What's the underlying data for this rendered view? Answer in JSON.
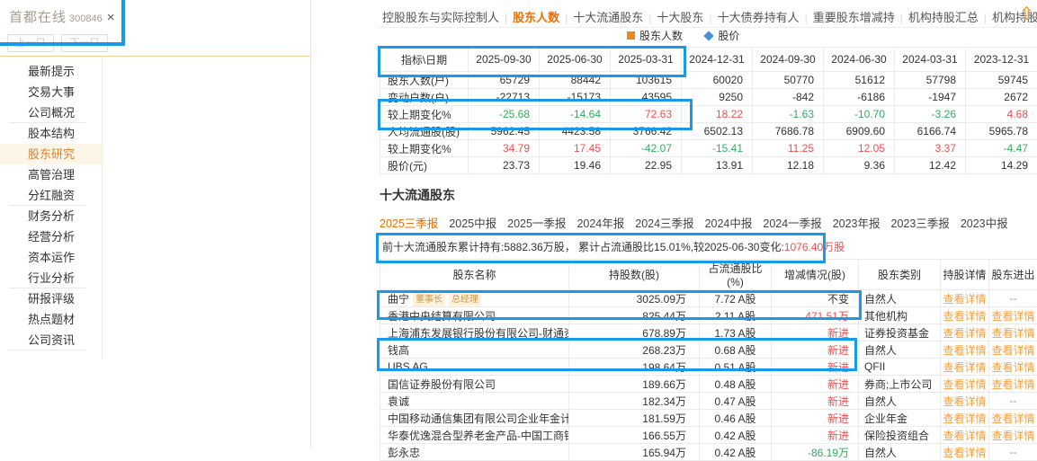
{
  "stock": {
    "name": "首都在线",
    "code": "300846",
    "close_icon": "×",
    "prev_label": "上一只",
    "next_label": "下一只"
  },
  "sidebar": {
    "items": [
      {
        "label": "最新提示"
      },
      {
        "label": "交易大事"
      },
      {
        "label": "公司概况",
        "divider": true
      },
      {
        "label": "股本结构"
      },
      {
        "label": "股东研究",
        "active": true
      },
      {
        "label": "高管治理"
      },
      {
        "label": "分红融资",
        "divider": true
      },
      {
        "label": "财务分析"
      },
      {
        "label": "经营分析"
      },
      {
        "label": "资本运作"
      },
      {
        "label": "行业分析",
        "divider": true
      },
      {
        "label": "研报评级"
      },
      {
        "label": "热点题材"
      },
      {
        "label": "公司资讯",
        "divider": true
      }
    ]
  },
  "nav": {
    "items": [
      "控股股东与实际控制人",
      "股东人数",
      "十大流通股东",
      "十大股东",
      "十大债券持有人",
      "重要股东增减持",
      "机构持股汇总",
      "机构持股明细"
    ],
    "active_index": 1
  },
  "icons": {
    "back_to_top": "⇧"
  },
  "legend": {
    "bar_label": "股东人数",
    "line_label": "股价"
  },
  "indicator_table": {
    "corner": "指标\\日期",
    "dates": [
      "2025-09-30",
      "2025-06-30",
      "2025-03-31",
      "2024-12-31",
      "2024-09-30",
      "2024-06-30",
      "2024-03-31",
      "2023-12-31"
    ],
    "rows": [
      {
        "label": "股东人数(户)",
        "values": [
          {
            "t": "65729"
          },
          {
            "t": "88442"
          },
          {
            "t": "103615"
          },
          {
            "t": "60020"
          },
          {
            "t": "50770"
          },
          {
            "t": "51612"
          },
          {
            "t": "57798"
          },
          {
            "t": "59745"
          }
        ]
      },
      {
        "label": "变动户数(户)",
        "values": [
          {
            "t": "-22713"
          },
          {
            "t": "-15173"
          },
          {
            "t": "43595"
          },
          {
            "t": "9250"
          },
          {
            "t": "-842"
          },
          {
            "t": "-6186"
          },
          {
            "t": "-1947"
          },
          {
            "t": "2672"
          }
        ]
      },
      {
        "label": "较上期变化%",
        "values": [
          {
            "t": "-25.68",
            "c": "down"
          },
          {
            "t": "-14.64",
            "c": "down"
          },
          {
            "t": "72.63",
            "c": "up"
          },
          {
            "t": "18.22",
            "c": "up"
          },
          {
            "t": "-1.63",
            "c": "down"
          },
          {
            "t": "-10.70",
            "c": "down"
          },
          {
            "t": "-3.26",
            "c": "down"
          },
          {
            "t": "4.68",
            "c": "up"
          }
        ]
      },
      {
        "label": "人均流通股(股)",
        "values": [
          {
            "t": "5962.45"
          },
          {
            "t": "4423.58"
          },
          {
            "t": "3766.42"
          },
          {
            "t": "6502.13"
          },
          {
            "t": "7686.78"
          },
          {
            "t": "6909.60"
          },
          {
            "t": "6166.74"
          },
          {
            "t": "5965.78"
          }
        ]
      },
      {
        "label": "较上期变化%",
        "values": [
          {
            "t": "34.79",
            "c": "up"
          },
          {
            "t": "17.45",
            "c": "up"
          },
          {
            "t": "-42.07",
            "c": "down"
          },
          {
            "t": "-15.41",
            "c": "down"
          },
          {
            "t": "11.25",
            "c": "up"
          },
          {
            "t": "12.05",
            "c": "up"
          },
          {
            "t": "3.37",
            "c": "up"
          },
          {
            "t": "-4.47",
            "c": "down"
          }
        ]
      },
      {
        "label": "股价(元)",
        "values": [
          {
            "t": "23.73"
          },
          {
            "t": "19.46"
          },
          {
            "t": "22.95"
          },
          {
            "t": "13.91"
          },
          {
            "t": "12.18"
          },
          {
            "t": "9.36"
          },
          {
            "t": "12.42"
          },
          {
            "t": "14.29"
          }
        ]
      }
    ]
  },
  "section2": {
    "title": "十大流通股东",
    "tabs": [
      "2025三季报",
      "2025中报",
      "2025一季报",
      "2024年报",
      "2024三季报",
      "2024中报",
      "2024一季报",
      "2023年报",
      "2023三季报",
      "2023中报"
    ],
    "active_tab": 0,
    "summary_prefix": "前十大流通股东累计持有:5882.36万股， 累计占流通股比15.01%,较2025-06-30变化:",
    "summary_highlight": "1076.40万股"
  },
  "holders_table": {
    "headers": [
      "股东名称",
      "持股数(股)",
      "占流通股比(%)",
      "增减情况(股)",
      "股东类别",
      "持股详情",
      "股东进出"
    ],
    "rows": [
      {
        "name": "曲宁",
        "badges": [
          "董事长",
          "总经理"
        ],
        "shares": "3025.09万",
        "ratio": "7.72 A股",
        "change": {
          "t": "不变"
        },
        "type": "自然人",
        "detail": "查看详情",
        "inout": "--"
      },
      {
        "name": "香港中央结算有限公司",
        "badges": [],
        "shares": "825.44万",
        "ratio": "2.11 A股",
        "change": {
          "t": "471.51万",
          "c": "up"
        },
        "type": "其他机构",
        "detail": "查看详情",
        "inout": "查看详情"
      },
      {
        "name": "上海浦东发展银行股份有限公司-财通资管数字经济混...",
        "badges": [],
        "shares": "678.89万",
        "ratio": "1.73 A股",
        "change": {
          "t": "新进",
          "c": "up"
        },
        "type": "证券投资基金",
        "detail": "查看详情",
        "inout": "查看详情"
      },
      {
        "name": "钱高",
        "badges": [],
        "shares": "268.23万",
        "ratio": "0.68 A股",
        "change": {
          "t": "新进",
          "c": "up"
        },
        "type": "自然人",
        "detail": "查看详情",
        "inout": "查看详情"
      },
      {
        "name": "UBS AG",
        "badges": [],
        "shares": "198.64万",
        "ratio": "0.51 A股",
        "change": {
          "t": "新进",
          "c": "up"
        },
        "type": "QFII",
        "detail": "查看详情",
        "inout": "查看详情"
      },
      {
        "name": "国信证券股份有限公司",
        "badges": [],
        "shares": "189.66万",
        "ratio": "0.48 A股",
        "change": {
          "t": "新进",
          "c": "up"
        },
        "type": "券商;上市公司",
        "detail": "查看详情",
        "inout": "查看详情"
      },
      {
        "name": "袁诚",
        "badges": [],
        "shares": "182.34万",
        "ratio": "0.47 A股",
        "change": {
          "t": "新进",
          "c": "up"
        },
        "type": "自然人",
        "detail": "查看详情",
        "inout": "--"
      },
      {
        "name": "中国移动通信集团有限公司企业年金计划-中国工商银...",
        "badges": [],
        "shares": "181.59万",
        "ratio": "0.46 A股",
        "change": {
          "t": "新进",
          "c": "up"
        },
        "type": "企业年金",
        "detail": "查看详情",
        "inout": "查看详情"
      },
      {
        "name": "华泰优逸混合型养老金产品-中国工商银行股份有限公...",
        "badges": [],
        "shares": "166.55万",
        "ratio": "0.42 A股",
        "change": {
          "t": "新进",
          "c": "up"
        },
        "type": "保险投资组合",
        "detail": "查看详情",
        "inout": "查看详情"
      },
      {
        "name": "彭永忠",
        "badges": [],
        "shares": "165.94万",
        "ratio": "0.42 A股",
        "change": {
          "t": "-86.19万",
          "c": "down"
        },
        "type": "自然人",
        "detail": "查看详情",
        "inout": "--"
      }
    ]
  },
  "colors": {
    "accent_orange": "#ee6f00",
    "link_orange": "#fb9e3c",
    "positive_red": "#fb4b4b",
    "negative_green": "#2fae5f",
    "annotation_blue": "#1799ec",
    "legend_bar": "#e8891f",
    "legend_line": "#4a90d9"
  }
}
